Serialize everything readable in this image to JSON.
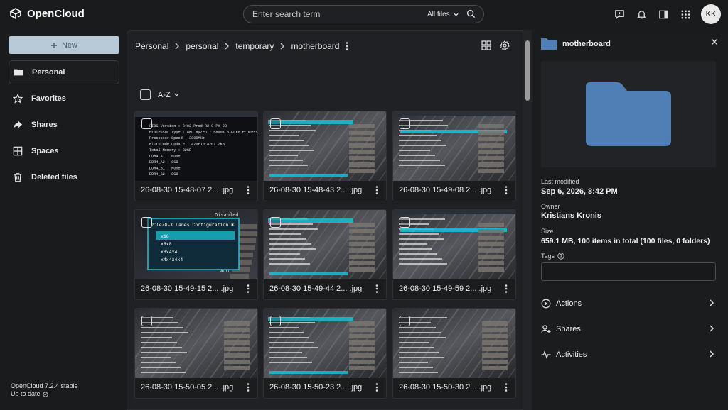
{
  "app": {
    "name": "OpenCloud",
    "version": "OpenCloud 7.2.4 stable",
    "update_status": "Up to date"
  },
  "search": {
    "placeholder": "Enter search term",
    "scope": "All files"
  },
  "user": {
    "initials": "KK"
  },
  "sidebar": {
    "new_label": "New",
    "items": [
      {
        "label": "Personal",
        "icon": "folder-icon"
      },
      {
        "label": "Favorites",
        "icon": "star-icon"
      },
      {
        "label": "Shares",
        "icon": "share-icon"
      },
      {
        "label": "Spaces",
        "icon": "spaces-icon"
      },
      {
        "label": "Deleted files",
        "icon": "trash-icon"
      }
    ]
  },
  "breadcrumb": [
    "Personal",
    "personal",
    "temporary",
    "motherboard"
  ],
  "sort": {
    "label": "A-Z"
  },
  "files": [
    {
      "name": "26-08-30 15-48-07 2... .jpg",
      "theme": "a"
    },
    {
      "name": "26-08-30 15-48-43 2... .jpg",
      "theme": "b"
    },
    {
      "name": "26-08-30 15-49-08 2... .jpg",
      "theme": "c"
    },
    {
      "name": "26-08-30 15-49-15 2... .jpg",
      "theme": "d"
    },
    {
      "name": "26-08-30 15-49-44 2... .jpg",
      "theme": "b"
    },
    {
      "name": "26-08-30 15-49-59 2... .jpg",
      "theme": "c"
    },
    {
      "name": "26-08-30 15-50-05 2... .jpg",
      "theme": "e"
    },
    {
      "name": "26-08-30 15-50-23 2... .jpg",
      "theme": "b"
    },
    {
      "name": "26-08-30 15-50-30 2... .jpg",
      "theme": "e"
    }
  ],
  "thumb_text": {
    "a": {
      "lines": [
        "BIOS Version : 8402 Prod R2.0 PX 98",
        "Processor Type : AMD Ryzen 7 5800X 8-Core Processor",
        "Processor Speed : 3800MHz",
        "Microcode Update : A20F10 A201 2KB",
        "Total Memory : 32GB",
        "DDR4_A1 : None",
        "DDR4_A2 : 8GB",
        "DDR4_B1 : None",
        "DDR4_B2 : 8GB"
      ]
    },
    "d": {
      "title": "PCIe/GFX Lanes Configuration",
      "disabled": "Disabled",
      "options": [
        "x16",
        "x8x8",
        "x8x4x4",
        "x4x4x4x4"
      ],
      "auto": "Auto"
    }
  },
  "panel": {
    "folder_name": "motherboard",
    "last_modified_label": "Last modified",
    "last_modified": "Sep 6, 2026, 8:42 PM",
    "owner_label": "Owner",
    "owner": "Kristians Kronis",
    "size_label": "Size",
    "size": "659.1 MB, 100 items in total (100 files, 0 folders)",
    "tags_label": "Tags",
    "actions_label": "Actions",
    "shares_label": "Shares",
    "activities_label": "Activities"
  },
  "colors": {
    "accent": "#4f7fb5",
    "new_button": "#b8c9d8",
    "bg": "#1a1b1d",
    "thumb_cyan": "#19c4d6"
  }
}
